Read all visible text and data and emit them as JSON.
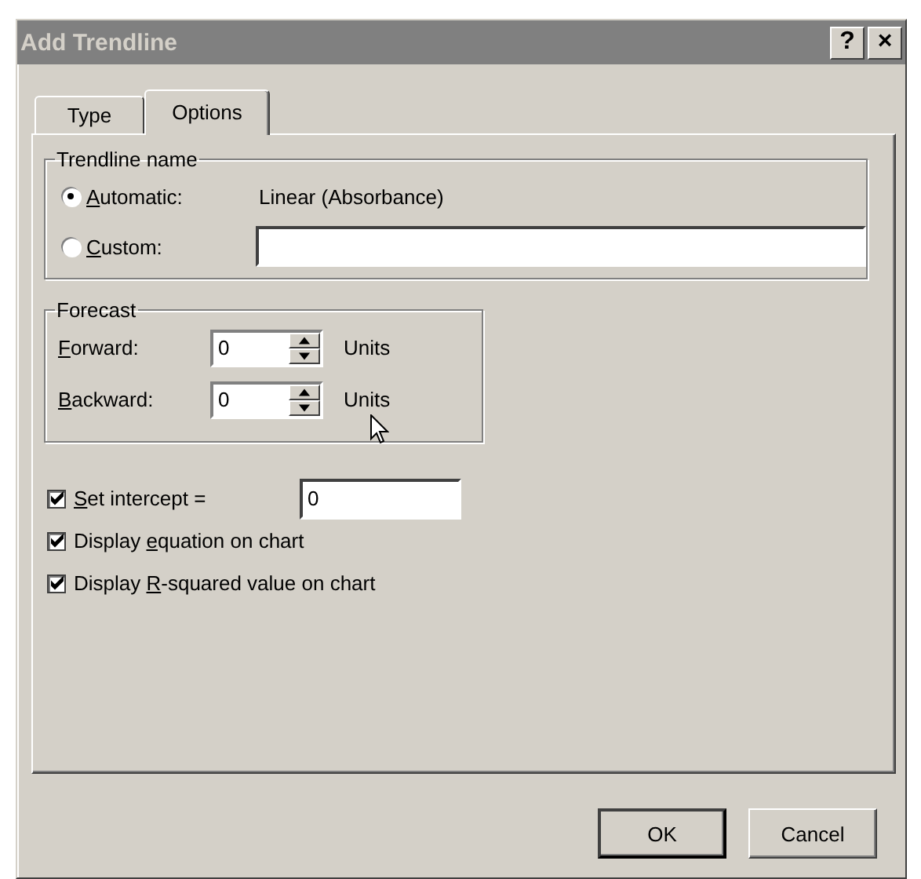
{
  "window": {
    "title": "Add Trendline",
    "help_button": "?",
    "close_button": "×"
  },
  "tabs": [
    {
      "label": "Type",
      "selected": false
    },
    {
      "label": "Options",
      "selected": true
    }
  ],
  "trendline_name": {
    "title": "Trendline name",
    "options": [
      {
        "kind": "text",
        "label": {
          "key": "A",
          "after": "utomatic:"
        },
        "selected": true,
        "value": "Linear (Absorbance)"
      },
      {
        "kind": "field",
        "label": {
          "key": "C",
          "after": "ustom:"
        },
        "selected": false
      }
    ]
  },
  "forecast": {
    "title": "Forecast",
    "rows": [
      {
        "label": {
          "key": "F",
          "after": "orward:"
        },
        "value": "0",
        "unit": "Units"
      },
      {
        "label": {
          "key": "B",
          "after": "ackward:"
        },
        "value": "0",
        "unit": "Units"
      }
    ]
  },
  "options": [
    {
      "label": {
        "key": "S",
        "after": "et intercept ="
      },
      "checked": true,
      "field": "0"
    },
    {
      "label": {
        "before": "Display ",
        "key": "e",
        "after": "quation on chart"
      },
      "checked": true
    },
    {
      "label": {
        "before": "Display ",
        "key": "R",
        "after": "-squared value on chart"
      },
      "checked": true
    }
  ],
  "buttons": [
    {
      "label": "OK",
      "default": true
    },
    {
      "label": "Cancel",
      "default": false
    }
  ]
}
